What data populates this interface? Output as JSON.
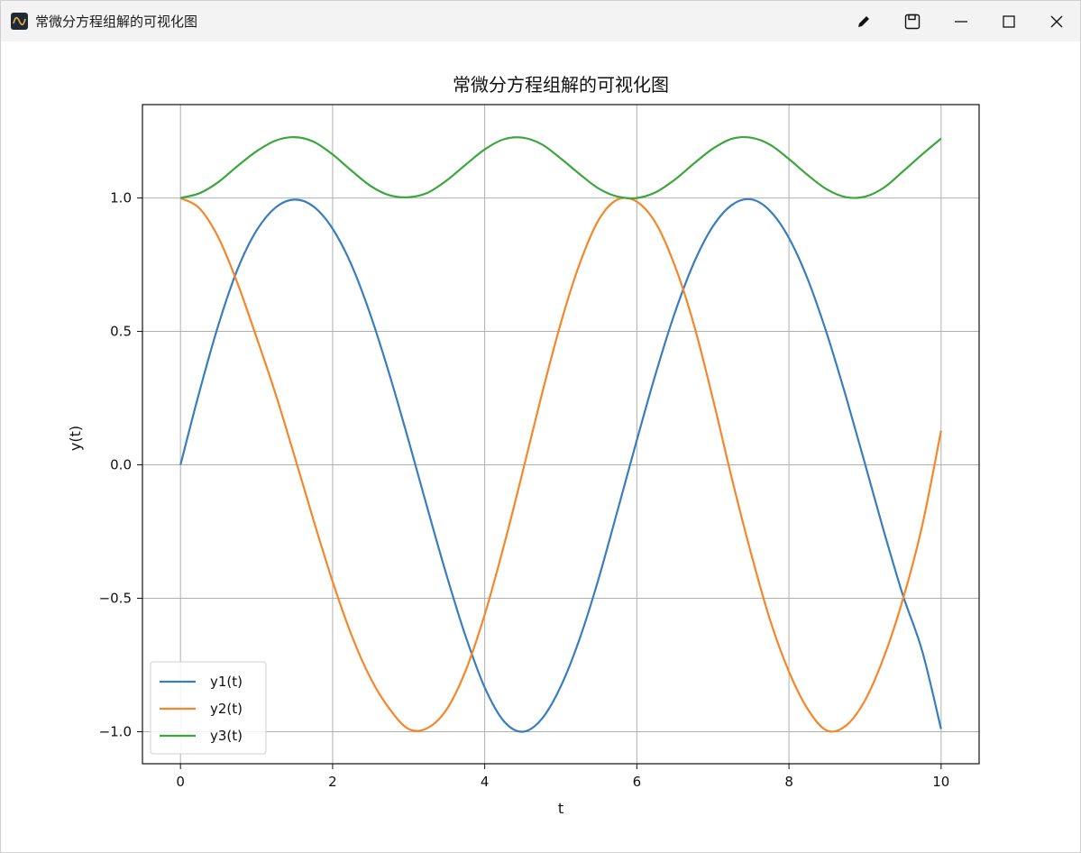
{
  "window": {
    "title": "常微分方程组解的可视化图",
    "app_icon": "waveform-icon",
    "controls": [
      "edit-icon",
      "save-icon",
      "minimize-icon",
      "maximize-icon",
      "close-icon"
    ]
  },
  "chart_data": {
    "type": "line",
    "title": "常微分方程组解的可视化图",
    "xlabel": "t",
    "ylabel": "y(t)",
    "xlim": [
      -0.5,
      10.5
    ],
    "ylim": [
      -1.12,
      1.35
    ],
    "xticks": [
      0,
      2,
      4,
      6,
      8,
      10
    ],
    "xtick_labels": [
      "0",
      "2",
      "4",
      "6",
      "8",
      "10"
    ],
    "yticks": [
      -1.0,
      -0.5,
      0.0,
      0.5,
      1.0
    ],
    "ytick_labels": [
      "−1.0",
      "−0.5",
      "0.0",
      "0.5",
      "1.0"
    ],
    "grid": true,
    "legend_position": "lower-left",
    "x": [
      0,
      0.25,
      0.5,
      0.75,
      1,
      1.25,
      1.5,
      1.75,
      2,
      2.25,
      2.5,
      2.75,
      3,
      3.25,
      3.5,
      3.75,
      4,
      4.25,
      4.5,
      4.75,
      5,
      5.25,
      5.5,
      5.75,
      6,
      6.25,
      6.5,
      6.75,
      7,
      7.25,
      7.5,
      7.75,
      8,
      8.25,
      8.5,
      8.75,
      9,
      9.25,
      9.5,
      9.75,
      10
    ],
    "series": [
      {
        "name": "y1(t)",
        "color": "#3a7dbf",
        "values": [
          0.0,
          0.275,
          0.526,
          0.733,
          0.878,
          0.964,
          0.994,
          0.968,
          0.885,
          0.748,
          0.56,
          0.336,
          0.09,
          -0.166,
          -0.415,
          -0.643,
          -0.834,
          -0.96,
          -1.0,
          -0.952,
          -0.83,
          -0.65,
          -0.424,
          -0.167,
          0.093,
          0.344,
          0.57,
          0.757,
          0.894,
          0.974,
          0.995,
          0.952,
          0.85,
          0.693,
          0.49,
          0.255,
          0.003,
          -0.251,
          -0.49,
          -0.696,
          -0.99
        ]
      },
      {
        "name": "y2(t)",
        "color": "#f5862a",
        "values": [
          1.0,
          0.961,
          0.851,
          0.68,
          0.478,
          0.266,
          0.032,
          -0.208,
          -0.437,
          -0.639,
          -0.8,
          -0.915,
          -0.99,
          -0.986,
          -0.916,
          -0.771,
          -0.561,
          -0.305,
          -0.025,
          0.263,
          0.531,
          0.755,
          0.919,
          0.995,
          0.986,
          0.905,
          0.746,
          0.526,
          0.247,
          -0.052,
          -0.33,
          -0.58,
          -0.775,
          -0.917,
          -0.996,
          -0.977,
          -0.882,
          -0.719,
          -0.502,
          -0.23,
          0.128
        ]
      },
      {
        "name": "y3(t)",
        "color": "#3ca63c",
        "values": [
          1.0,
          1.018,
          1.06,
          1.12,
          1.175,
          1.215,
          1.228,
          1.211,
          1.163,
          1.102,
          1.045,
          1.01,
          1.003,
          1.02,
          1.066,
          1.125,
          1.182,
          1.22,
          1.226,
          1.201,
          1.148,
          1.089,
          1.035,
          1.005,
          1.0,
          1.022,
          1.069,
          1.129,
          1.185,
          1.222,
          1.226,
          1.2,
          1.146,
          1.085,
          1.032,
          1.003,
          1.005,
          1.039,
          1.1,
          1.163,
          1.223
        ]
      }
    ]
  }
}
